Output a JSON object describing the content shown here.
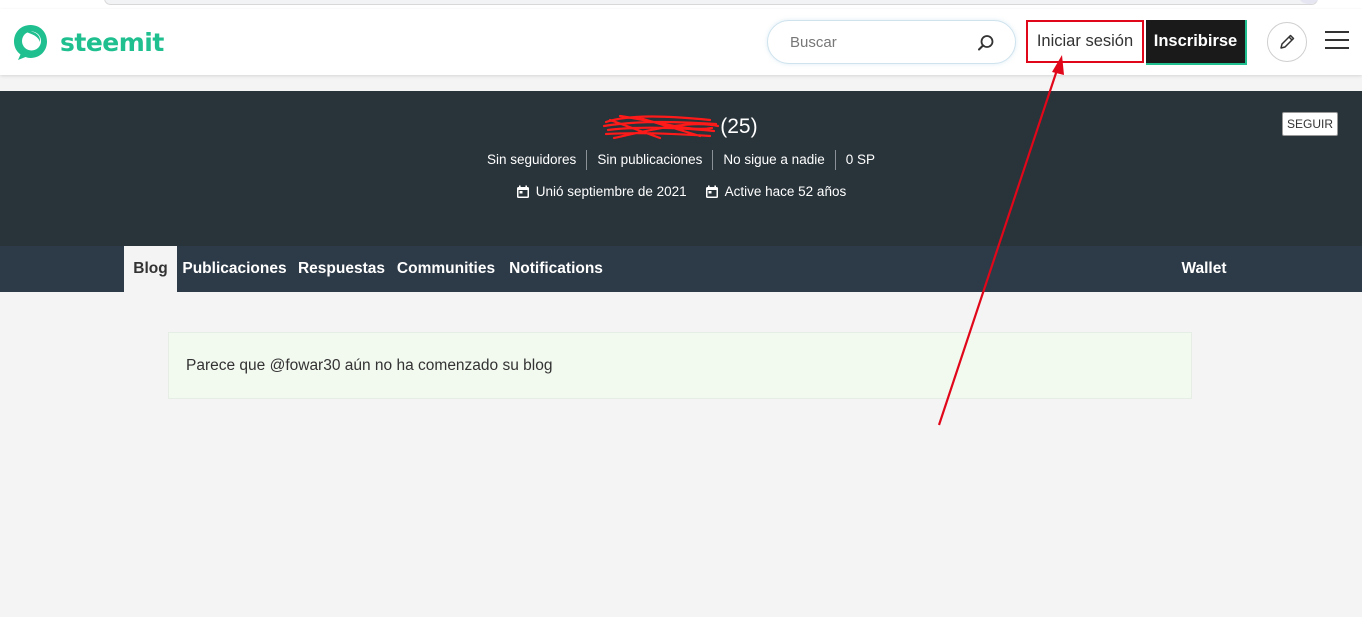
{
  "header": {
    "logo_text": "steemit",
    "search_placeholder": "Buscar",
    "login_label": "Iniciar sesión",
    "signup_label": "Inscribirse",
    "brand_color": "#1fbf8f"
  },
  "profile": {
    "reputation": "(25)",
    "follow_label": "SEGUIR",
    "stats": [
      "Sin seguidores",
      "Sin publicaciones",
      "No sigue a nadie",
      "0 SP"
    ],
    "joined": "Unió septiembre de 2021",
    "active": "Active hace 52 años"
  },
  "tabs": [
    "Blog",
    "Publicaciones",
    "Respuestas",
    "Communities",
    "Notifications"
  ],
  "wallet_label": "Wallet",
  "notice": "Parece que @fowar30 aún no ha comenzado su blog",
  "annotation_color": "#e1071a"
}
